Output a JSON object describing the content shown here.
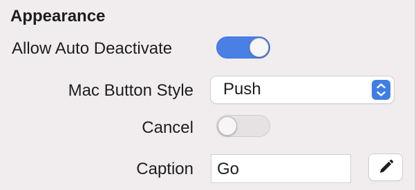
{
  "section": {
    "title": "Appearance"
  },
  "allow_auto_deactivate": {
    "label": "Allow Auto Deactivate",
    "enabled": true
  },
  "mac_button_style": {
    "label": "Mac Button Style",
    "selected": "Push"
  },
  "cancel": {
    "label": "Cancel",
    "enabled": false
  },
  "caption": {
    "label": "Caption",
    "value": "Go"
  },
  "icons": {
    "popup_arrows": "chevron-up-down-icon",
    "edit": "pencil-icon"
  },
  "colors": {
    "accent": "#4a80e6",
    "background": "#f1edee"
  }
}
